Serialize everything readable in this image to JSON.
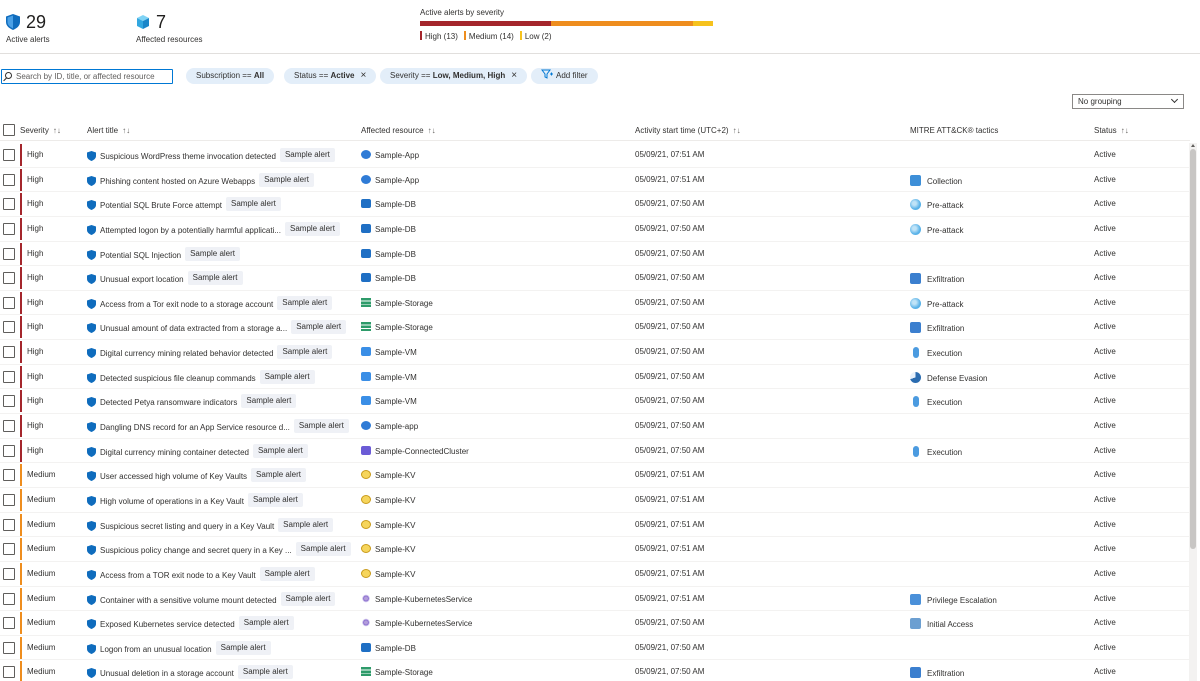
{
  "summary": {
    "active_alerts_count": "29",
    "active_alerts_label": "Active alerts",
    "affected_resources_count": "7",
    "affected_resources_label": "Affected resources",
    "severity_title": "Active alerts by severity",
    "severity_counts": {
      "high": 13,
      "medium": 14,
      "low": 2
    },
    "legend": {
      "high": "High (13)",
      "medium": "Medium (14)",
      "low": "Low (2)"
    },
    "colors": {
      "high": "#a4262c",
      "medium": "#ee8d1e",
      "low": "#f6c21d"
    }
  },
  "filters": {
    "search_placeholder": "Search by ID, title, or affected resource",
    "subscription_label": "Subscription == ",
    "subscription_value": "All",
    "status_label": "Status == ",
    "status_value": "Active",
    "severity_label": "Severity == ",
    "severity_value": "Low, Medium, High",
    "add_filter_label": "Add filter",
    "grouping_value": "No grouping"
  },
  "table": {
    "columns": {
      "severity": "Severity",
      "title": "Alert title",
      "resource": "Affected resource",
      "time": "Activity start time (UTC+2)",
      "tactics": "MITRE ATT&CK® tactics",
      "status": "Status"
    },
    "sort_glyph": "↑↓",
    "tag_label": "Sample alert",
    "rows": [
      {
        "severity": "High",
        "title": "Suspicious WordPress theme invocation detected",
        "resource": "Sample-App",
        "rtype": "app",
        "time": "05/09/21, 07:51 AM",
        "tactic": "",
        "ttype": "",
        "status": "Active"
      },
      {
        "severity": "High",
        "title": "Phishing content hosted on Azure Webapps",
        "resource": "Sample-App",
        "rtype": "app",
        "time": "05/09/21, 07:51 AM",
        "tactic": "Collection",
        "ttype": "collection",
        "status": "Active"
      },
      {
        "severity": "High",
        "title": "Potential SQL Brute Force attempt",
        "resource": "Sample-DB",
        "rtype": "db",
        "time": "05/09/21, 07:50 AM",
        "tactic": "Pre-attack",
        "ttype": "preattack",
        "status": "Active"
      },
      {
        "severity": "High",
        "title": "Attempted logon by a potentially harmful applicati...",
        "resource": "Sample-DB",
        "rtype": "db",
        "time": "05/09/21, 07:50 AM",
        "tactic": "Pre-attack",
        "ttype": "preattack",
        "status": "Active"
      },
      {
        "severity": "High",
        "title": "Potential SQL Injection",
        "resource": "Sample-DB",
        "rtype": "db",
        "time": "05/09/21, 07:50 AM",
        "tactic": "",
        "ttype": "",
        "status": "Active"
      },
      {
        "severity": "High",
        "title": "Unusual export location",
        "resource": "Sample-DB",
        "rtype": "db",
        "time": "05/09/21, 07:50 AM",
        "tactic": "Exfiltration",
        "ttype": "exfil",
        "status": "Active"
      },
      {
        "severity": "High",
        "title": "Access from a Tor exit node to a storage account",
        "resource": "Sample-Storage",
        "rtype": "storage",
        "time": "05/09/21, 07:50 AM",
        "tactic": "Pre-attack",
        "ttype": "preattack",
        "status": "Active"
      },
      {
        "severity": "High",
        "title": "Unusual amount of data extracted from a storage a...",
        "resource": "Sample-Storage",
        "rtype": "storage",
        "time": "05/09/21, 07:50 AM",
        "tactic": "Exfiltration",
        "ttype": "exfil",
        "status": "Active"
      },
      {
        "severity": "High",
        "title": "Digital currency mining related behavior detected",
        "resource": "Sample-VM",
        "rtype": "vm",
        "time": "05/09/21, 07:50 AM",
        "tactic": "Execution",
        "ttype": "execution",
        "status": "Active"
      },
      {
        "severity": "High",
        "title": "Detected suspicious file cleanup commands",
        "resource": "Sample-VM",
        "rtype": "vm",
        "time": "05/09/21, 07:50 AM",
        "tactic": "Defense Evasion",
        "ttype": "evasion",
        "status": "Active"
      },
      {
        "severity": "High",
        "title": "Detected Petya ransomware indicators",
        "resource": "Sample-VM",
        "rtype": "vm",
        "time": "05/09/21, 07:50 AM",
        "tactic": "Execution",
        "ttype": "execution",
        "status": "Active"
      },
      {
        "severity": "High",
        "title": "Dangling DNS record for an App Service resource d...",
        "resource": "Sample-app",
        "rtype": "app",
        "time": "05/09/21, 07:50 AM",
        "tactic": "",
        "ttype": "",
        "status": "Active"
      },
      {
        "severity": "High",
        "title": "Digital currency mining container detected",
        "resource": "Sample-ConnectedCluster",
        "rtype": "cluster",
        "time": "05/09/21, 07:50 AM",
        "tactic": "Execution",
        "ttype": "execution",
        "status": "Active"
      },
      {
        "severity": "Medium",
        "title": "User accessed high volume of Key Vaults",
        "resource": "Sample-KV",
        "rtype": "kv",
        "time": "05/09/21, 07:51 AM",
        "tactic": "",
        "ttype": "",
        "status": "Active"
      },
      {
        "severity": "Medium",
        "title": "High volume of operations in a Key Vault",
        "resource": "Sample-KV",
        "rtype": "kv",
        "time": "05/09/21, 07:51 AM",
        "tactic": "",
        "ttype": "",
        "status": "Active"
      },
      {
        "severity": "Medium",
        "title": "Suspicious secret listing and query in a Key Vault",
        "resource": "Sample-KV",
        "rtype": "kv",
        "time": "05/09/21, 07:51 AM",
        "tactic": "",
        "ttype": "",
        "status": "Active"
      },
      {
        "severity": "Medium",
        "title": "Suspicious policy change and secret query in a Key ...",
        "resource": "Sample-KV",
        "rtype": "kv",
        "time": "05/09/21, 07:51 AM",
        "tactic": "",
        "ttype": "",
        "status": "Active"
      },
      {
        "severity": "Medium",
        "title": "Access from a TOR exit node to a Key Vault",
        "resource": "Sample-KV",
        "rtype": "kv",
        "time": "05/09/21, 07:51 AM",
        "tactic": "",
        "ttype": "",
        "status": "Active"
      },
      {
        "severity": "Medium",
        "title": "Container with a sensitive volume mount detected",
        "resource": "Sample-KubernetesService",
        "rtype": "k8s",
        "time": "05/09/21, 07:51 AM",
        "tactic": "Privilege Escalation",
        "ttype": "privesc",
        "status": "Active"
      },
      {
        "severity": "Medium",
        "title": "Exposed Kubernetes service detected",
        "resource": "Sample-KubernetesService",
        "rtype": "k8s",
        "time": "05/09/21, 07:50 AM",
        "tactic": "Initial Access",
        "ttype": "initial",
        "status": "Active"
      },
      {
        "severity": "Medium",
        "title": "Logon from an unusual location",
        "resource": "Sample-DB",
        "rtype": "db",
        "time": "05/09/21, 07:50 AM",
        "tactic": "",
        "ttype": "",
        "status": "Active"
      },
      {
        "severity": "Medium",
        "title": "Unusual deletion in a storage account",
        "resource": "Sample-Storage",
        "rtype": "storage",
        "time": "05/09/21, 07:50 AM",
        "tactic": "Exfiltration",
        "ttype": "exfil",
        "status": "Active"
      }
    ]
  },
  "icons": {
    "resource": {
      "app": "app-service-icon",
      "db": "sql-database-icon",
      "storage": "storage-account-icon",
      "vm": "virtual-machine-icon",
      "cluster": "connected-cluster-icon",
      "kv": "key-vault-icon",
      "k8s": "kubernetes-service-icon"
    },
    "tactic": {
      "collection": "collection-icon",
      "preattack": "pre-attack-icon",
      "exfil": "exfiltration-icon",
      "execution": "execution-icon",
      "evasion": "defense-evasion-icon",
      "privesc": "privilege-escalation-icon",
      "initial": "initial-access-icon"
    }
  }
}
